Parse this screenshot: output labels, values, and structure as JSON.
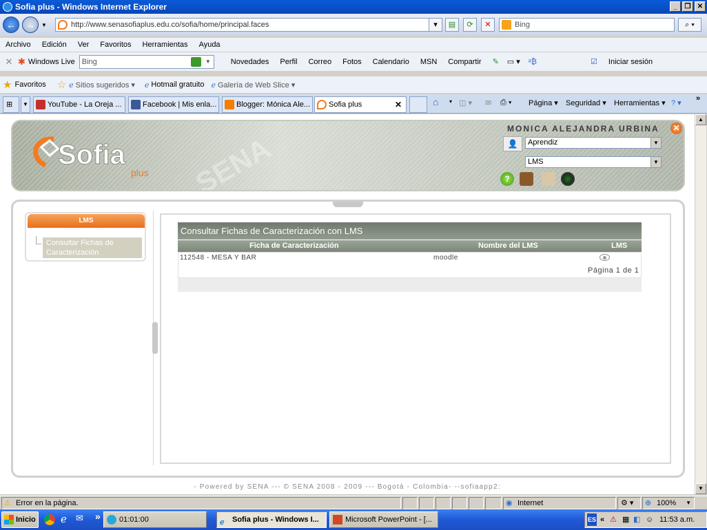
{
  "window": {
    "title": "Sofia plus - Windows Internet Explorer"
  },
  "browser": {
    "url": "http://www.senasofiaplus.edu.co/sofia/home/principal.faces",
    "search_placeholder": "Bing",
    "menu": [
      "Archivo",
      "Edición",
      "Ver",
      "Favoritos",
      "Herramientas",
      "Ayuda"
    ],
    "live_label": "Windows Live",
    "live_search": "Bing",
    "live_links": [
      "Novedades",
      "Perfil",
      "Correo",
      "Fotos",
      "Calendario",
      "MSN",
      "Compartir"
    ],
    "signin": "Iniciar sesión",
    "favorites_label": "Favoritos",
    "favorites": [
      "Sitios sugeridos ▾",
      "Hotmail gratuito",
      "Galería de Web Slice ▾"
    ],
    "tabs": [
      "YouTube - La Oreja ...",
      "Facebook | Mis enla...",
      "Blogger: Mónica Ale...",
      "Sofia plus"
    ],
    "tab_tools": [
      "Página ▾",
      "Seguridad ▾",
      "Herramientas ▾"
    ]
  },
  "page": {
    "user_name": "MONICA ALEJANDRA URBINA",
    "role_select": "Aprendiz",
    "module_select": "LMS",
    "left_menu_title": "LMS",
    "left_menu_item": "Consultar Fichas de Caracterización",
    "content_title": "Consultar Fichas de Caracterización con LMS",
    "table": {
      "headers": [
        "Ficha de Caracterización",
        "Nombre del LMS",
        "LMS"
      ],
      "rows": [
        {
          "ficha": "112548 - MESA Y BAR",
          "lms": "moodle"
        }
      ],
      "pagination": "Página 1 de 1"
    },
    "footer": "- Powered by SENA --- © SENA 2008 - 2009 --- Bogotá - Colombia- --sofiaapp2:"
  },
  "status": {
    "text": "Error en la página.",
    "zone": "Internet",
    "zoom": "100%"
  },
  "taskbar": {
    "start": "Inicio",
    "timer": "01:01:00",
    "tasks": [
      "Sofia plus - Windows I...",
      "Microsoft PowerPoint - [..."
    ],
    "lang": "ES",
    "clock": "11:53 a.m."
  }
}
